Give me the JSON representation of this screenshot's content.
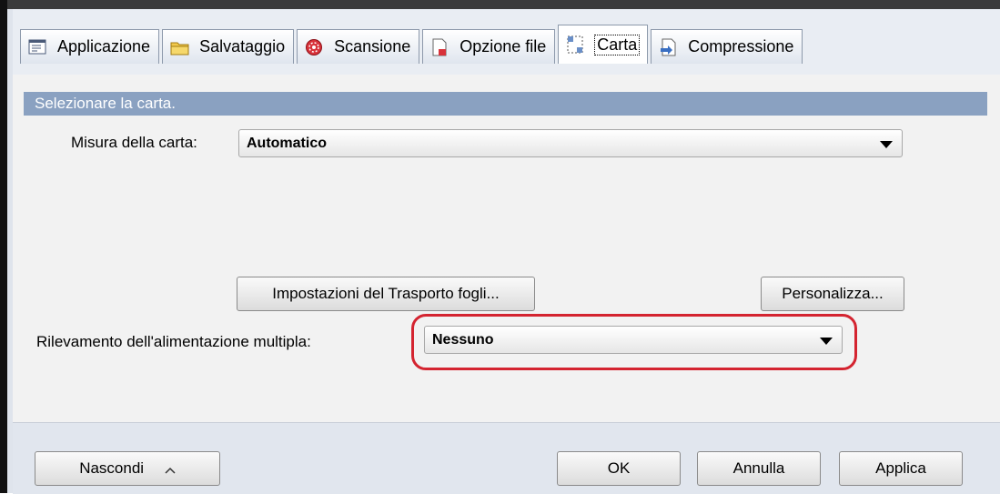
{
  "tabs": [
    {
      "label": "Applicazione",
      "icon": "application-icon"
    },
    {
      "label": "Salvataggio",
      "icon": "folder-icon"
    },
    {
      "label": "Scansione",
      "icon": "scan-icon"
    },
    {
      "label": "Opzione file",
      "icon": "file-icon"
    },
    {
      "label": "Carta",
      "icon": "paper-icon",
      "active": true
    },
    {
      "label": "Compressione",
      "icon": "compression-icon"
    }
  ],
  "section": {
    "title": "Selezionare la carta."
  },
  "paper_size": {
    "label": "Misura della carta:",
    "value": "Automatico"
  },
  "buttons": {
    "transport": "Impostazioni del Trasporto fogli...",
    "customize": "Personalizza..."
  },
  "multifeed": {
    "label": "Rilevamento dell'alimentazione multipla:",
    "value": "Nessuno"
  },
  "footer": {
    "hide": "Nascondi",
    "ok": "OK",
    "cancel": "Annulla",
    "apply": "Applica"
  },
  "colors": {
    "section_header": "#8aa1c1",
    "highlight": "#d42430",
    "background": "#f2f2f2"
  }
}
